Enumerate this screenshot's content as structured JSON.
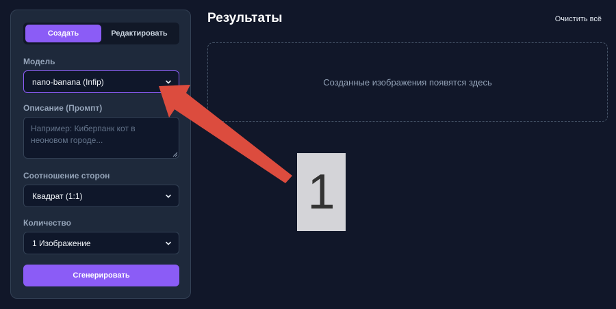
{
  "tabs": {
    "create": "Создать",
    "edit": "Редактировать"
  },
  "model": {
    "label": "Модель",
    "value": "nano-banana (Infip)"
  },
  "prompt": {
    "label": "Описание (Промпт)",
    "placeholder": "Например: Киберпанк кот в неоновом городе..."
  },
  "aspect": {
    "label": "Соотношение сторон",
    "value": "Квадрат (1:1)"
  },
  "count": {
    "label": "Количество",
    "value": "1 Изображение"
  },
  "generate_label": "Сгенерировать",
  "results": {
    "title": "Результаты",
    "clear_label": "Очистить всё",
    "empty_text": "Созданные изображения появятся здесь"
  },
  "annotation": {
    "marker_label": "1",
    "arrow_color": "#dc4c3e"
  },
  "colors": {
    "accent": "#8b5cf6",
    "background": "#111729",
    "panel": "#1e293b"
  }
}
